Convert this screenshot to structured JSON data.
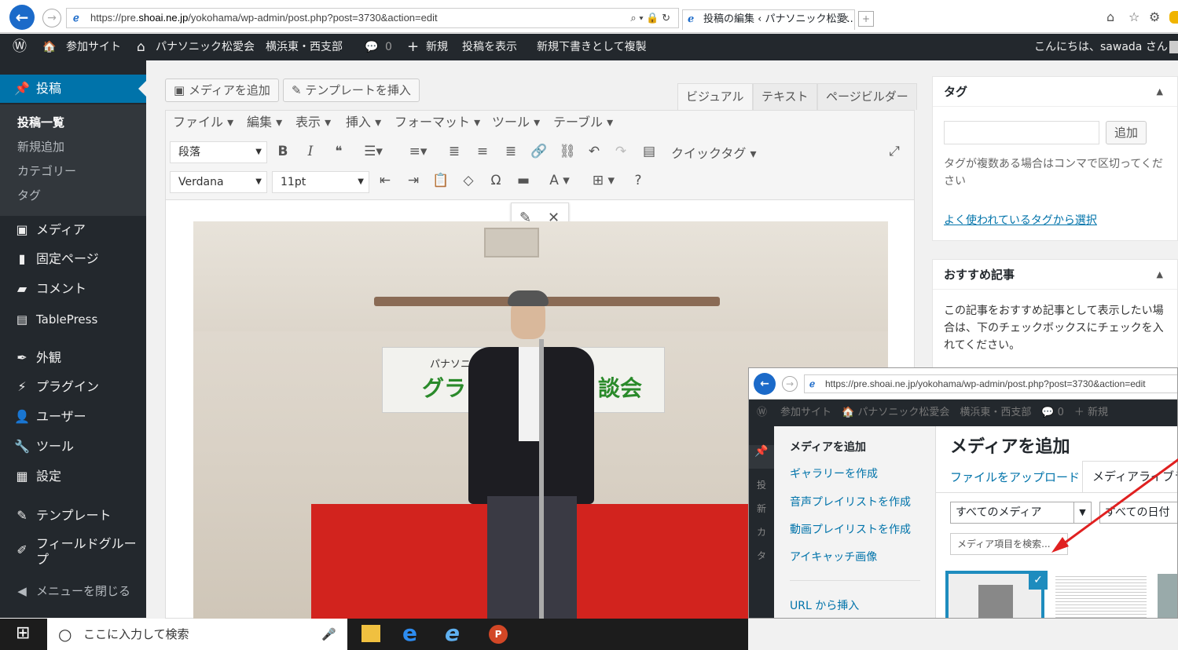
{
  "browser": {
    "url_prefix": "https://pre.",
    "url_host": "shoai.ne.jp",
    "url_path": "/yokohama/wp-admin/post.php?post=3730&action=edit",
    "url_controls": "⌕ ▾ 🔒 ↻",
    "tab_title": "投稿の編集 ‹ パナソニック松愛...",
    "tab_close": "×"
  },
  "adminbar": {
    "wp_logo": "Ⓦ",
    "site_icon": "🏠",
    "sites": "参加サイト",
    "home_icon": "⌂",
    "site_name": "パナソニック松愛会　横浜東・西支部",
    "comment_icon": "💬",
    "comments": "0",
    "plus_icon": "+",
    "new": "新規",
    "view_post": "投稿を表示",
    "duplicate": "新規下書きとして複製",
    "greeting": "こんにちは、sawada さん"
  },
  "sidebar": {
    "posts": "投稿",
    "sub": [
      "投稿一覧",
      "新規追加",
      "カテゴリー",
      "タグ"
    ],
    "items": [
      "メディア",
      "固定ページ",
      "コメント",
      "TablePress",
      "外観",
      "プラグイン",
      "ユーザー",
      "ツール",
      "設定",
      "テンプレート",
      "フィールドグループ",
      "メニューを閉じる"
    ]
  },
  "editor": {
    "add_media": "メディアを追加",
    "insert_template": "テンプレートを挿入",
    "tabs": [
      "ビジュアル",
      "テキスト",
      "ページビルダー"
    ],
    "menus": [
      "ファイル ▾",
      "編集 ▾",
      "表示 ▾",
      "挿入 ▾",
      "フォーマット ▾",
      "ツール ▾",
      "テーブル ▾"
    ],
    "format_select": "段落",
    "quick_tags": "クイックタグ ▾",
    "font_select": "Verdana",
    "size_select": "11pt",
    "bar1_tools": [
      "B",
      "I",
      "❝",
      "☰▾",
      "≡▾",
      "≣",
      "≡",
      "≣",
      "🔗",
      "⛓",
      "↶",
      "↷",
      "▤"
    ],
    "bar2_tools": [
      "⇤",
      "⇥",
      "📋",
      "◇",
      "Ω",
      "▬",
      "A ▾",
      "⊞ ▾",
      "?"
    ],
    "fullscreen_icon": "⤢",
    "edit_icon": "✎",
    "close_icon": "✕",
    "banner_line1": "パナソニ　　　　　西支部",
    "banner_line2": "グラン　　　　　談会"
  },
  "tags_panel": {
    "title": "タグ",
    "add_button": "追加",
    "hint": "タグが複数ある場合はコンマで区切ってください",
    "popular_link": "よく使われているタグから選択"
  },
  "recommend_panel": {
    "title": "おすすめ記事",
    "desc": "この記事をおすすめ記事として表示したい場合は、下のチェックボックスにチェックを入れてください。"
  },
  "overlay": {
    "url": "https://pre.shoai.ne.jp/yokohama/wp-admin/post.php?post=3730&action=edit",
    "adminbar_text": "参加サイト　🏠 パナソニック松愛会　横浜東・西支部　💬 0　＋ 新規",
    "left_menu": [
      "メディアを追加",
      "ギャラリーを作成",
      "音声プレイリストを作成",
      "動画プレイリストを作成",
      "アイキャッチ画像",
      "URL から挿入"
    ],
    "side_labels": [
      "投",
      "新",
      "カ",
      "タ"
    ],
    "heading": "メディアを追加",
    "tab_upload": "ファイルをアップロード",
    "tab_library": "メディアライブラリ",
    "filter_all": "すべてのメディア",
    "filter_date": "すべての日付",
    "search_placeholder": "メディア項目を検索...",
    "check_icon": "✓"
  },
  "taskbar": {
    "search_placeholder": "ここに入力して検索",
    "mic_icon": "🎤",
    "windows_icon": "⊞"
  },
  "colors": {
    "admin_dark": "#23282d",
    "accent": "#0073aa",
    "arrow": "#e02020"
  }
}
